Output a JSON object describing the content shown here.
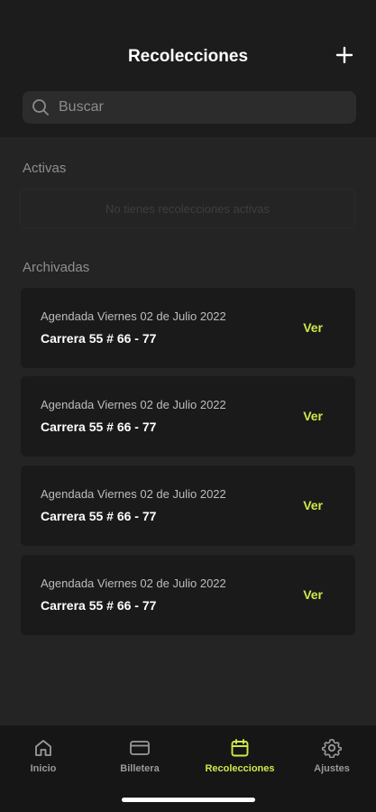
{
  "header": {
    "title": "Recolecciones",
    "add_icon": "plus-icon"
  },
  "search": {
    "placeholder": "Buscar",
    "icon": "search-icon"
  },
  "active": {
    "label": "Activas",
    "empty_text": "No tienes recolecciones activas"
  },
  "archived": {
    "label": "Archivadas",
    "items": [
      {
        "date": "Agendada Viernes 02 de Julio 2022",
        "address": "Carrera 55 # 66 - 77",
        "action": "Ver"
      },
      {
        "date": "Agendada Viernes 02 de Julio 2022",
        "address": "Carrera 55 # 66 - 77",
        "action": "Ver"
      },
      {
        "date": "Agendada Viernes 02 de Julio 2022",
        "address": "Carrera 55 # 66 - 77",
        "action": "Ver"
      },
      {
        "date": "Agendada Viernes 02 de Julio 2022",
        "address": "Carrera 55 # 66 - 77",
        "action": "Ver"
      }
    ]
  },
  "tabbar": {
    "tabs": [
      {
        "label": "Inicio",
        "icon": "home-icon",
        "active": false
      },
      {
        "label": "Billetera",
        "icon": "wallet-icon",
        "active": false
      },
      {
        "label": "Recolecciones",
        "icon": "calendar-icon",
        "active": true
      },
      {
        "label": "Ajustes",
        "icon": "gear-icon",
        "active": false
      }
    ]
  },
  "colors": {
    "accent": "#cfe84b",
    "background": "#242424",
    "card": "#1a1a1a"
  }
}
